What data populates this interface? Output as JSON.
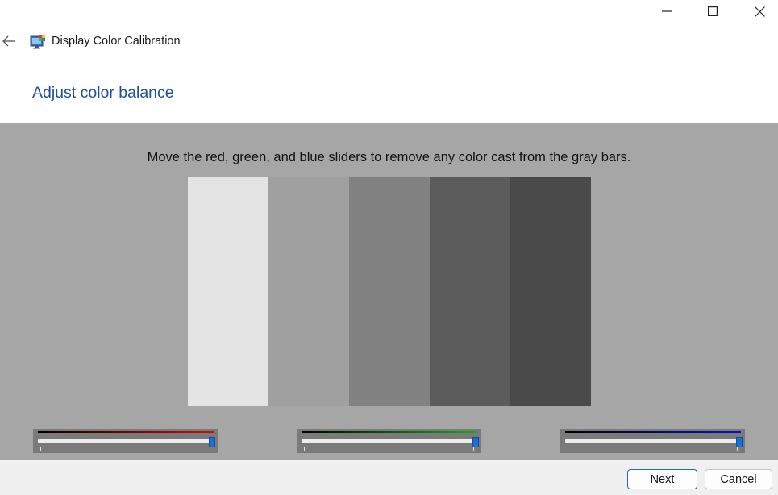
{
  "window": {
    "title": "Display Color Calibration",
    "controls": {
      "minimize_icon": "minimize-icon",
      "maximize_icon": "maximize-icon",
      "close_icon": "close-icon"
    },
    "back_icon": "back-arrow-icon",
    "app_icon": "display-color-calibration-icon"
  },
  "page": {
    "heading": "Adjust color balance",
    "instruction": "Move the red, green, and blue sliders to remove any color cast from the gray bars.",
    "gray_bars": [
      "#e4e4e4",
      "#a0a0a0",
      "#828282",
      "#5c5c5c",
      "#4a4a4a"
    ],
    "sliders": [
      {
        "channel": "red",
        "color": "#c81010",
        "value_percent": 100
      },
      {
        "channel": "green",
        "color": "#1aaa1a",
        "value_percent": 100
      },
      {
        "channel": "blue",
        "color": "#1010b4",
        "value_percent": 100
      }
    ]
  },
  "footer": {
    "next_label": "Next",
    "cancel_label": "Cancel"
  },
  "colors": {
    "heading": "#1f4e9a",
    "panel_background": "#a6a6a6",
    "accent": "#1e6fd0"
  }
}
